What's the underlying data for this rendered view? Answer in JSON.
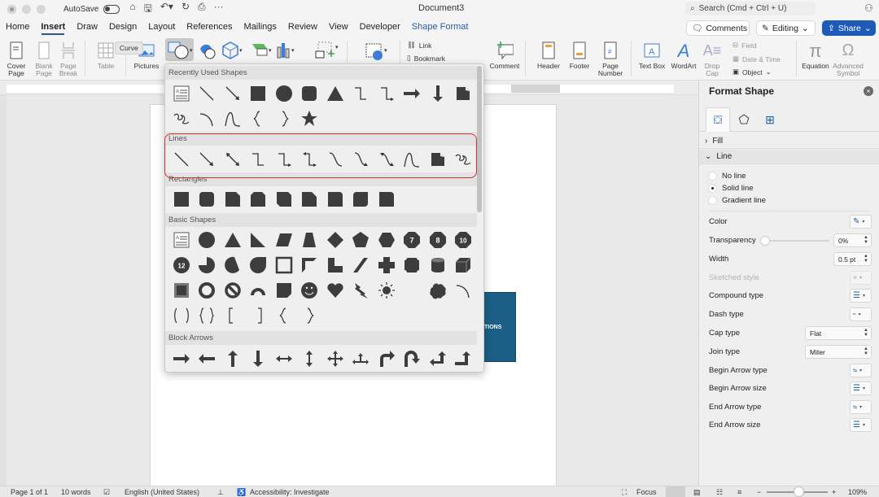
{
  "titlebar": {
    "autosave_label": "AutoSave",
    "document_title": "Document3",
    "search_placeholder": "Search (Cmd + Ctrl + U)"
  },
  "tabs": [
    {
      "label": "Home"
    },
    {
      "label": "Insert",
      "active": true
    },
    {
      "label": "Draw"
    },
    {
      "label": "Design"
    },
    {
      "label": "Layout"
    },
    {
      "label": "References"
    },
    {
      "label": "Mailings"
    },
    {
      "label": "Review"
    },
    {
      "label": "View"
    },
    {
      "label": "Developer"
    },
    {
      "label": "Shape Format"
    }
  ],
  "header_buttons": {
    "comments": "Comments",
    "editing": "Editing",
    "share": "Share"
  },
  "ribbon": {
    "cover_page": "Cover\nPage",
    "blank_page": "Blank\nPage",
    "page_break": "Page\nBreak",
    "table": "Table",
    "pictures": "Pictures",
    "tooltip": "Curve",
    "link": "Link",
    "bookmark": "Bookmark",
    "comment": "Comment",
    "header": "Header",
    "footer": "Footer",
    "page_number": "Page\nNumber",
    "text_box": "Text Box",
    "wordart": "WordArt",
    "drop_cap": "Drop\nCap",
    "field": "Field",
    "date_time": "Date & Time",
    "object": "Object",
    "equation": "Equation",
    "advanced_symbol": "Advanced\nSymbol"
  },
  "shapes_menu": {
    "categories": [
      {
        "label": "Recently Used Shapes"
      },
      {
        "label": "Lines"
      },
      {
        "label": "Rectangles"
      },
      {
        "label": "Basic Shapes"
      },
      {
        "label": "Block Arrows"
      }
    ],
    "highlight_color": "#d03232",
    "basic_numbers": [
      "7",
      "8",
      "10",
      "12"
    ]
  },
  "document": {
    "box_text": "TIONS",
    "box_color": "#1c5f86"
  },
  "format_panel": {
    "title": "Format Shape",
    "sections": {
      "fill": "Fill",
      "line": "Line"
    },
    "line_options": [
      {
        "label": "No line",
        "selected": false
      },
      {
        "label": "Solid line",
        "selected": true
      },
      {
        "label": "Gradient line",
        "selected": false
      }
    ],
    "rows": {
      "color": "Color",
      "transparency": "Transparency",
      "transparency_value": "0%",
      "width": "Width",
      "width_value": "0.5 pt",
      "sketched": "Sketched style",
      "compound": "Compound type",
      "dash": "Dash type",
      "cap": "Cap type",
      "cap_value": "Flat",
      "join": "Join type",
      "join_value": "Miter",
      "begin_arrow_type": "Begin Arrow type",
      "begin_arrow_size": "Begin Arrow size",
      "end_arrow_type": "End Arrow type",
      "end_arrow_size": "End Arrow size"
    },
    "accent_color": "#1d5fa8"
  },
  "status": {
    "page": "Page 1 of 1",
    "words": "10 words",
    "language": "English (United States)",
    "accessibility": "Accessibility: Investigate",
    "focus": "Focus",
    "zoom": "109%"
  }
}
